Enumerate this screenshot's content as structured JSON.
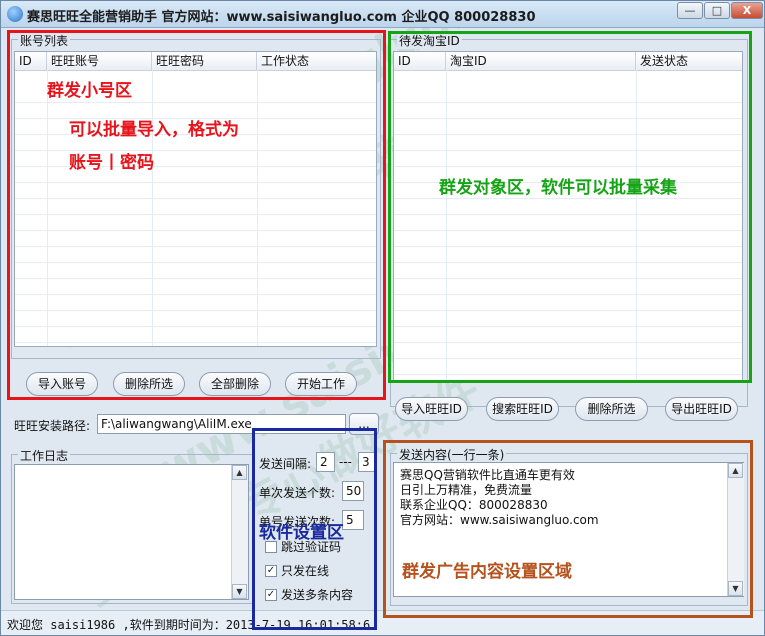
{
  "window": {
    "title": "赛思旺旺全能营销助手  官方网站：www.saisiwangluo.com  企业QQ 800028830",
    "minimize_symbol": "—",
    "maximize_symbol": "□",
    "close_symbol": "X"
  },
  "accounts": {
    "group_title": "账号列表",
    "columns": [
      "ID",
      "旺旺账号",
      "旺旺密码",
      "工作状态"
    ],
    "buttons": {
      "import": "导入账号",
      "delete_selected": "删除所选",
      "delete_all": "全部删除",
      "start": "开始工作"
    }
  },
  "targets": {
    "group_title": "待发淘宝ID",
    "columns": [
      "ID",
      "淘宝ID",
      "发送状态"
    ],
    "buttons": {
      "import": "导入旺旺ID",
      "search": "搜索旺旺ID",
      "delete_selected": "删除所选",
      "export": "导出旺旺ID"
    }
  },
  "install_path": {
    "label": "旺旺安装路径:",
    "value": "F:\\aliwangwang\\AliIM.exe",
    "browse_label": "..."
  },
  "log": {
    "group_title": "工作日志"
  },
  "settings": {
    "interval_label": "发送间隔:",
    "interval_from": "2",
    "interval_sep": "---",
    "interval_to": "3",
    "per_send_label": "单次发送个数:",
    "per_send_value": "50",
    "per_account_label": "单号发送次数:",
    "per_account_value": "5",
    "skip_captcha_label": "跳过验证码",
    "skip_captcha_checked": false,
    "online_only_label": "只发在线",
    "online_only_checked": true,
    "multi_content_label": "发送多条内容",
    "multi_content_checked": true
  },
  "content": {
    "group_title": "发送内容(一行一条)",
    "text": "赛思QQ营销软件比直通车更有效\n日引上万精准，免费流量\n联系企业QQ：800028830\n官方网站：www.saisiwangluo.com"
  },
  "status": {
    "text": "欢迎您 saisi1986 ,软件到期时间为：2013-7-19 16:01:58:6"
  },
  "annotations": {
    "accounts_area": "群发小号区",
    "import_hint_1": "可以批量导入，格式为",
    "import_hint_2": "账号丨密码",
    "targets_area": "群发对象区，软件可以批量采集",
    "settings_area": "软件设置区",
    "content_area": "群发广告内容设置区域"
  },
  "watermark": {
    "text_1": "www.saisiwangluo.com",
    "text_2": "赛思软件专心做好软件"
  },
  "colors": {
    "annotation_red": "#e8141b",
    "annotation_green": "#16a316",
    "annotation_navy": "#1a2a9e",
    "annotation_brown": "#b5521e",
    "window_bg": "#dfe8f1"
  }
}
